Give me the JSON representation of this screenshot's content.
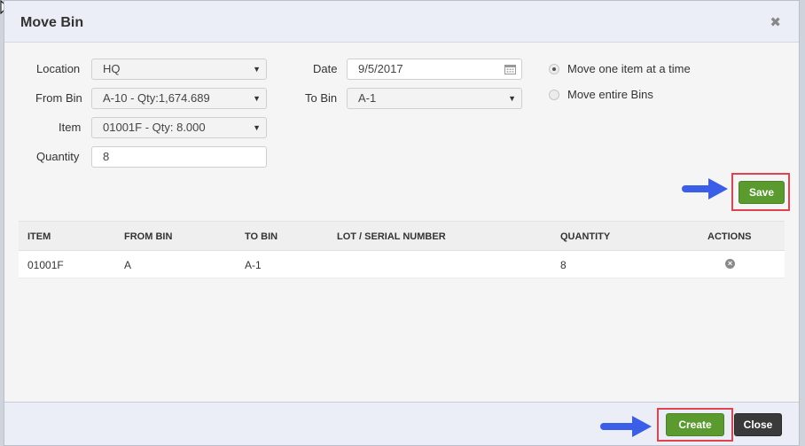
{
  "modal": {
    "title": "Move Bin",
    "close_icon": "✖"
  },
  "form": {
    "location_label": "Location",
    "location_value": "HQ",
    "from_bin_label": "From Bin",
    "from_bin_value": "A-10 - Qty:1,674.689",
    "item_label": "Item",
    "item_value": "01001F - Qty: 8.000",
    "quantity_label": "Quantity",
    "quantity_value": "8",
    "date_label": "Date",
    "date_value": "9/5/2017",
    "to_bin_label": "To Bin",
    "to_bin_value": "A-1"
  },
  "options": {
    "move_one": "Move one item at a time",
    "move_entire": "Move entire Bins",
    "selected": "move_one"
  },
  "buttons": {
    "save": "Save",
    "create": "Create",
    "close": "Close"
  },
  "table": {
    "headers": [
      "ITEM",
      "FROM BIN",
      "TO BIN",
      "LOT / SERIAL NUMBER",
      "QUANTITY",
      "ACTIONS"
    ],
    "rows": [
      {
        "item": "01001F",
        "from_bin": "A",
        "to_bin": "A-1",
        "lot_serial": "",
        "quantity": "8"
      }
    ]
  },
  "colors": {
    "accent_green": "#5b9a2e",
    "highlight_red": "#e2424e",
    "arrow_blue": "#3a5ee8"
  }
}
